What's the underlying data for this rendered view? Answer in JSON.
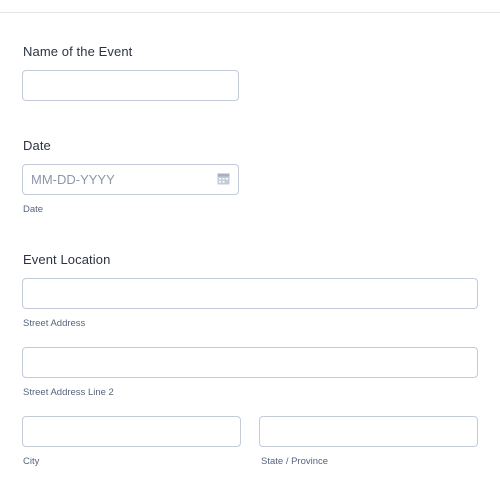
{
  "event_name": {
    "label": "Name of the Event",
    "value": ""
  },
  "date": {
    "label": "Date",
    "placeholder": "MM-DD-YYYY",
    "sublabel": "Date",
    "icon": "calendar-icon"
  },
  "location": {
    "label": "Event Location",
    "street": {
      "sublabel": "Street Address",
      "value": ""
    },
    "street2": {
      "sublabel": "Street Address Line 2",
      "value": ""
    },
    "city": {
      "sublabel": "City",
      "value": ""
    },
    "state": {
      "sublabel": "State / Province",
      "value": ""
    }
  }
}
